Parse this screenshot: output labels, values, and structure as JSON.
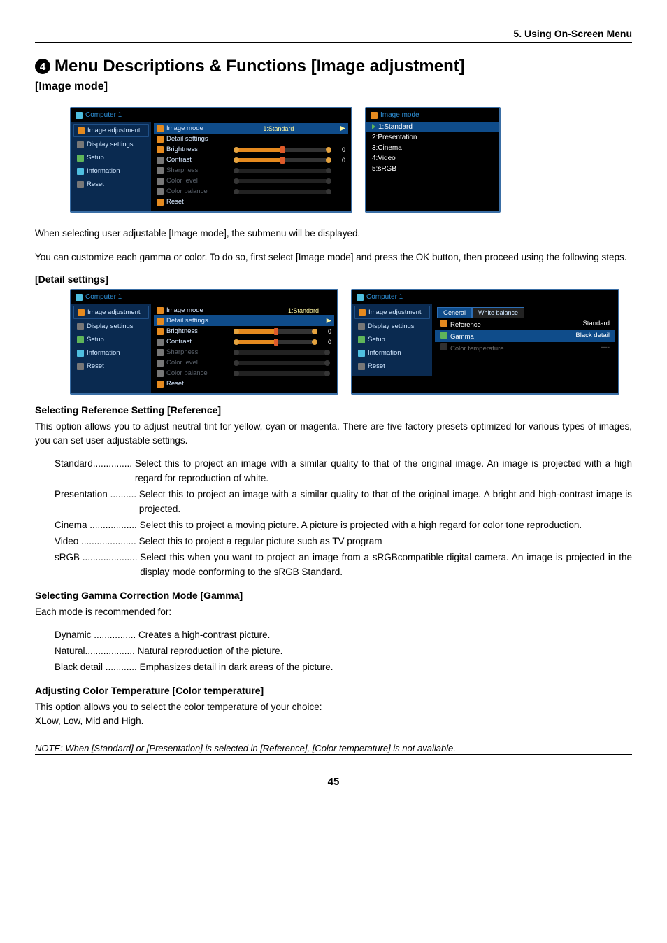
{
  "chapter_header": "5. Using On-Screen Menu",
  "title_number": "4",
  "main_title": "Menu Descriptions & Functions [Image adjustment]",
  "sub_title": "[Image mode]",
  "page_number": "45",
  "osd_main": {
    "title": "Computer 1",
    "sidebar": [
      "Image adjustment",
      "Display settings",
      "Setup",
      "Information",
      "Reset"
    ],
    "rows": {
      "image_mode": "Image mode",
      "image_mode_val": "1:Standard",
      "detail_settings": "Detail settings",
      "brightness": "Brightness",
      "brightness_val": "0",
      "contrast": "Contrast",
      "contrast_val": "0",
      "sharpness": "Sharpness",
      "color_level": "Color level",
      "color_balance": "Color balance",
      "reset": "Reset"
    }
  },
  "osd_list": {
    "title": "Image mode",
    "items": [
      "1:Standard",
      "2:Presentation",
      "3:Cinema",
      "4:Video",
      "5:sRGB"
    ]
  },
  "para1": "When selecting user adjustable [Image mode], the submenu will be displayed.",
  "para2": "You can customize each gamma or color. To do so, first select [Image mode] and press the OK button, then proceed using the following steps.",
  "detail_heading": "[Detail settings]",
  "osd_detail2": {
    "tabs": [
      "General",
      "White balance"
    ],
    "reference": "Reference",
    "reference_val": "Standard",
    "gamma": "Gamma",
    "gamma_val": "Black detail",
    "color_temp": "Color temperature",
    "color_temp_val": "----"
  },
  "ref_heading": "Selecting Reference Setting [Reference]",
  "ref_para": "This option allows you to adjust neutral tint for yellow, cyan or magenta. There are five factory presets optimized for various types of images, you can set user adjustable settings.",
  "ref_defs": [
    {
      "term": "Standard",
      "dots": "...............",
      "desc": "Select this to project an image with a similar quality to that of the original image. An image is projected with a high regard for reproduction of white."
    },
    {
      "term": "Presentation ",
      "dots": "..........",
      "desc": "Select this to project an image with a similar quality to that of the original image. A bright and high-contrast image is projected."
    },
    {
      "term": "Cinema ",
      "dots": "..................",
      "desc": "Select this to project a moving picture. A picture is projected with a high regard for color tone reproduction."
    },
    {
      "term": "Video ",
      "dots": ".....................",
      "desc": "Select this to project a regular picture such as TV program"
    },
    {
      "term": "sRGB ",
      "dots": ".....................",
      "desc": "Select this when you want to project an image from a sRGBcompatible digital camera. An image is projected in the display mode conforming to the sRGB Standard."
    }
  ],
  "gamma_heading": "Selecting Gamma Correction Mode [Gamma]",
  "gamma_para": "Each mode is recommended for:",
  "gamma_defs": [
    {
      "term": "Dynamic ",
      "dots": "................",
      "desc": "Creates a high-contrast picture."
    },
    {
      "term": "Natural",
      "dots": "...................",
      "desc": "Natural reproduction of the picture."
    },
    {
      "term": "Black detail ",
      "dots": "............",
      "desc": "Emphasizes detail in dark areas of the picture."
    }
  ],
  "ct_heading": "Adjusting Color Temperature [Color temperature]",
  "ct_para1": "This option allows you to select the color temperature of your choice:",
  "ct_para2": "XLow, Low, Mid and High.",
  "note": "NOTE: When [Standard] or [Presentation] is selected in [Reference], [Color temperature] is not available."
}
